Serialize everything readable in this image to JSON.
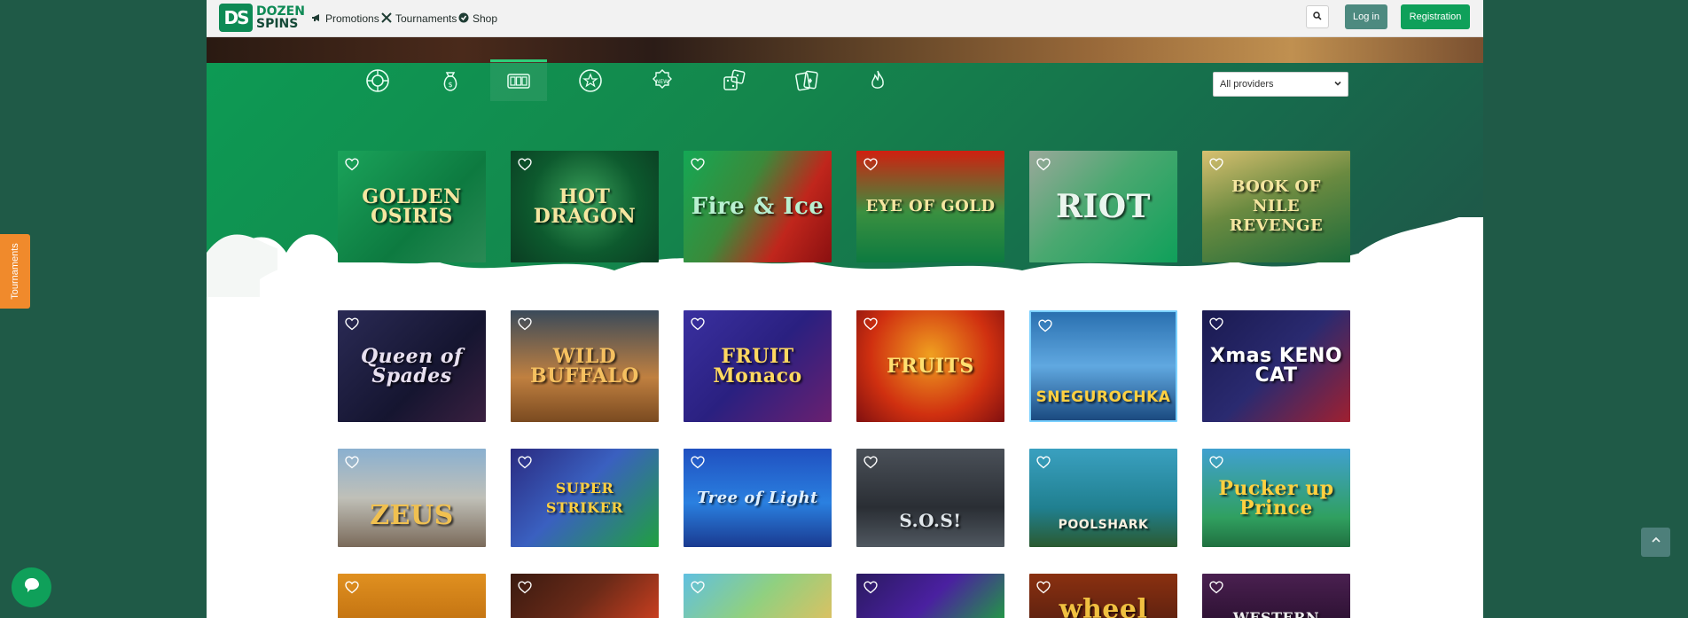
{
  "header": {
    "logo_top": "DOZEN",
    "logo_bottom": "SPINS",
    "logo_mark": "DS",
    "nav": [
      {
        "label": "Promotions",
        "icon": "megaphone-icon"
      },
      {
        "label": "Tournaments",
        "icon": "crossed-swords-icon"
      },
      {
        "label": "Shop",
        "icon": "check-badge-icon"
      }
    ],
    "search_icon": "search-icon",
    "login_label": "Log in",
    "register_label": "Registration"
  },
  "categories": [
    {
      "name": "all-games",
      "icon": "roulette-icon",
      "active": false
    },
    {
      "name": "jackpot",
      "icon": "money-bag-icon",
      "active": false
    },
    {
      "name": "slots",
      "icon": "slot-machine-icon",
      "active": true
    },
    {
      "name": "popular",
      "icon": "star-icon",
      "active": false
    },
    {
      "name": "new",
      "icon": "new-badge-icon",
      "active": false
    },
    {
      "name": "table-games",
      "icon": "dice-icon",
      "active": false
    },
    {
      "name": "card-games",
      "icon": "cards-icon",
      "active": false
    },
    {
      "name": "hot",
      "icon": "flame-icon",
      "active": false
    }
  ],
  "providers_select": {
    "selected": "All providers"
  },
  "games": [
    [
      {
        "title": "GOLDEN OSIRIS"
      },
      {
        "title": "HOT DRAGON"
      },
      {
        "title": "Fire & Ice"
      },
      {
        "title": "EYE OF GOLD"
      },
      {
        "title": "RIOT"
      },
      {
        "title": "BOOK OF NILE REVENGE"
      }
    ],
    [
      {
        "title": "Queen of Spades"
      },
      {
        "title": "WILD BUFFALO"
      },
      {
        "title": "FRUIT Monaco"
      },
      {
        "title": "FRUITS"
      },
      {
        "title": "SNEGUROCHKA"
      },
      {
        "title": "Xmas KENO CAT"
      }
    ],
    [
      {
        "title": "ZEUS"
      },
      {
        "title": "SUPER STRIKER"
      },
      {
        "title": "Tree of Light"
      },
      {
        "title": "S.O.S!"
      },
      {
        "title": "POOLSHARK"
      },
      {
        "title": "Pucker up Prince"
      }
    ],
    [
      {
        "title": ""
      },
      {
        "title": ""
      },
      {
        "title": ""
      },
      {
        "title": ""
      },
      {
        "title": "wheel"
      },
      {
        "title": "WESTERN"
      }
    ]
  ],
  "side": {
    "tournaments_tab": "Tournaments",
    "chat_icon": "chat-bubble-icon",
    "scroll_top_icon": "chevron-up-icon"
  },
  "colors": {
    "brand_green": "#0fa05a",
    "login_teal": "#4d8a80",
    "page_bg": "#1f5a47",
    "tournaments_orange": "#f08a2c"
  }
}
